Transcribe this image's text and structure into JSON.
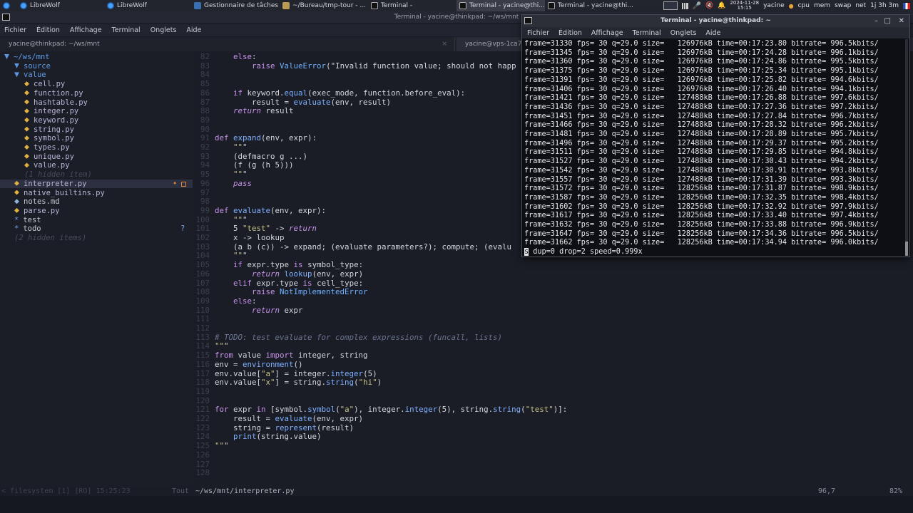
{
  "taskbar": {
    "tasks": [
      {
        "label": "LibreWolf",
        "icon": "librewolf-icon"
      },
      {
        "label": "LibreWolf",
        "icon": "librewolf-icon"
      },
      {
        "label": "Gestionnaire de tâches",
        "icon": "task-manager-icon"
      },
      {
        "label": "~/Bureau/tmp-tour - ...",
        "icon": "folder-icon"
      },
      {
        "label": "Terminal -",
        "icon": "terminal-icon"
      },
      {
        "label": "Terminal - yacine@thi...",
        "icon": "terminal-icon"
      },
      {
        "label": "Terminal - yacine@thi...",
        "icon": "terminal-icon"
      }
    ],
    "tray": {
      "date": "2024-11-28",
      "time": "15:15",
      "user": "yacine",
      "cpu": "cpu",
      "mem": "mem",
      "swap": "swap",
      "net": "net",
      "uptime": "1j 3h 3m"
    }
  },
  "editor": {
    "title": "Terminal - yacine@thinkpad: ~/ws/mnt",
    "menu": [
      "Fichier",
      "Édition",
      "Affichage",
      "Terminal",
      "Onglets",
      "Aide"
    ],
    "tabs": [
      "yacine@thinkpad: ~/ws/mnt",
      "yacine@vps-1ca7..."
    ],
    "tree": [
      {
        "label": "~/ws/mnt",
        "kind": "dir"
      },
      {
        "label": "source",
        "kind": "dir"
      },
      {
        "label": "value",
        "kind": "dir"
      },
      {
        "label": "cell.py",
        "kind": "py"
      },
      {
        "label": "function.py",
        "kind": "py"
      },
      {
        "label": "hashtable.py",
        "kind": "py"
      },
      {
        "label": "integer.py",
        "kind": "py"
      },
      {
        "label": "keyword.py",
        "kind": "py"
      },
      {
        "label": "string.py",
        "kind": "py"
      },
      {
        "label": "symbol.py",
        "kind": "py"
      },
      {
        "label": "types.py",
        "kind": "py"
      },
      {
        "label": "unique.py",
        "kind": "py"
      },
      {
        "label": "value.py",
        "kind": "py"
      },
      {
        "label": "(1 hidden item)",
        "kind": "hidden"
      },
      {
        "label": "interpreter.py",
        "kind": "py"
      },
      {
        "label": "native_builtins.py",
        "kind": "py"
      },
      {
        "label": "notes.md",
        "kind": "md"
      },
      {
        "label": "parse.py",
        "kind": "py"
      },
      {
        "label": "test",
        "kind": "star"
      },
      {
        "label": "todo",
        "kind": "star"
      },
      {
        "label": "(2 hidden items)",
        "kind": "hidden"
      }
    ],
    "tree_marks": {
      "modified": "•",
      "question": "?"
    },
    "code": [
      {
        "n": "82",
        "t": "    else:"
      },
      {
        "n": "83",
        "t": "        raise ValueError(\"Invalid function value; should not happ"
      },
      {
        "n": "84",
        "t": ""
      },
      {
        "n": "85",
        "t": ""
      },
      {
        "n": "86",
        "t": "    if keyword.equal(exec_mode, function.before_eval):"
      },
      {
        "n": "87",
        "t": "        result = evaluate(env, result)"
      },
      {
        "n": "88",
        "t": "    return result"
      },
      {
        "n": "89",
        "t": ""
      },
      {
        "n": "90",
        "t": ""
      },
      {
        "n": "91",
        "t": "def expand(env, expr):"
      },
      {
        "n": "92",
        "t": "    \"\"\""
      },
      {
        "n": "93",
        "t": "    (defmacro g ...)"
      },
      {
        "n": "94",
        "t": "    (f (g (h 5)))"
      },
      {
        "n": "95",
        "t": "    \"\"\""
      },
      {
        "n": "96",
        "t": "    pass"
      },
      {
        "n": "97",
        "t": ""
      },
      {
        "n": "98",
        "t": ""
      },
      {
        "n": "99",
        "t": "def evaluate(env, expr):"
      },
      {
        "n": "100",
        "t": "    \"\"\""
      },
      {
        "n": "101",
        "t": "    5 \"test\" -> return"
      },
      {
        "n": "102",
        "t": "    x -> lookup"
      },
      {
        "n": "103",
        "t": "    (a b (c)) -> expand; (evaluate parameters?); compute; (evalu"
      },
      {
        "n": "104",
        "t": "    \"\"\""
      },
      {
        "n": "105",
        "t": "    if expr.type is symbol_type:"
      },
      {
        "n": "106",
        "t": "        return lookup(env, expr)"
      },
      {
        "n": "107",
        "t": "    elif expr.type is cell_type:"
      },
      {
        "n": "108",
        "t": "        raise NotImplementedError"
      },
      {
        "n": "109",
        "t": "    else:"
      },
      {
        "n": "110",
        "t": "        return expr"
      },
      {
        "n": "111",
        "t": ""
      },
      {
        "n": "112",
        "t": ""
      },
      {
        "n": "113",
        "t": "# TODO: test evaluate for complex expressions (funcall, lists)"
      },
      {
        "n": "114",
        "t": "\"\"\""
      },
      {
        "n": "115",
        "t": "from value import integer, string"
      },
      {
        "n": "116",
        "t": "env = environment()"
      },
      {
        "n": "117",
        "t": "env.value[\"a\"] = integer.integer(5)"
      },
      {
        "n": "118",
        "t": "env.value[\"x\"] = string.string(\"hi\")"
      },
      {
        "n": "119",
        "t": ""
      },
      {
        "n": "120",
        "t": ""
      },
      {
        "n": "121",
        "t": "for expr in [symbol.symbol(\"a\"), integer.integer(5), string.string(\"test\")]:"
      },
      {
        "n": "122",
        "t": "    result = evaluate(env, expr)"
      },
      {
        "n": "123",
        "t": "    string = represent(result)"
      },
      {
        "n": "124",
        "t": "    print(string.value)"
      },
      {
        "n": "125",
        "t": "\"\"\""
      },
      {
        "n": "126",
        "t": ""
      },
      {
        "n": "127",
        "t": ""
      },
      {
        "n": "128",
        "t": ""
      }
    ],
    "status": {
      "left": "< filesystem [1] [RO] 15:25:23",
      "tout": "Tout",
      "path": "~/ws/mnt/interpreter.py",
      "position": "96,7",
      "percent": "82%"
    }
  },
  "terminal": {
    "title": "Terminal - yacine@thinkpad: ~",
    "menu": [
      "Fichier",
      "Édition",
      "Affichage",
      "Terminal",
      "Onglets",
      "Aide"
    ],
    "lines": [
      "frame=31330 fps= 30 q=29.0 size=   126976kB time=00:17:23.80 bitrate= 996.5kbits/",
      "frame=31345 fps= 30 q=29.0 size=   126976kB time=00:17:24.28 bitrate= 996.1kbits/",
      "frame=31360 fps= 30 q=29.0 size=   126976kB time=00:17:24.86 bitrate= 995.5kbits/",
      "frame=31375 fps= 30 q=29.0 size=   126976kB time=00:17:25.34 bitrate= 995.1kbits/",
      "frame=31391 fps= 30 q=29.0 size=   126976kB time=00:17:25.82 bitrate= 994.6kbits/",
      "frame=31406 fps= 30 q=29.0 size=   126976kB time=00:17:26.40 bitrate= 994.1kbits/",
      "frame=31421 fps= 30 q=29.0 size=   127488kB time=00:17:26.88 bitrate= 997.6kbits/",
      "frame=31436 fps= 30 q=29.0 size=   127488kB time=00:17:27.36 bitrate= 997.2kbits/",
      "frame=31451 fps= 30 q=29.0 size=   127488kB time=00:17:27.84 bitrate= 996.7kbits/",
      "frame=31466 fps= 30 q=29.0 size=   127488kB time=00:17:28.32 bitrate= 996.2kbits/",
      "frame=31481 fps= 30 q=29.0 size=   127488kB time=00:17:28.89 bitrate= 995.7kbits/",
      "frame=31496 fps= 30 q=29.0 size=   127488kB time=00:17:29.37 bitrate= 995.2kbits/",
      "frame=31511 fps= 30 q=29.0 size=   127488kB time=00:17:29.85 bitrate= 994.8kbits/",
      "frame=31527 fps= 30 q=29.0 size=   127488kB time=00:17:30.43 bitrate= 994.2kbits/",
      "frame=31542 fps= 30 q=29.0 size=   127488kB time=00:17:30.91 bitrate= 993.8kbits/",
      "frame=31557 fps= 30 q=29.0 size=   127488kB time=00:17:31.39 bitrate= 993.3kbits/",
      "frame=31572 fps= 30 q=29.0 size=   128256kB time=00:17:31.87 bitrate= 998.9kbits/",
      "frame=31587 fps= 30 q=29.0 size=   128256kB time=00:17:32.35 bitrate= 998.4kbits/",
      "frame=31602 fps= 30 q=29.0 size=   128256kB time=00:17:32.92 bitrate= 997.9kbits/",
      "frame=31617 fps= 30 q=29.0 size=   128256kB time=00:17:33.40 bitrate= 997.4kbits/",
      "frame=31632 fps= 30 q=29.0 size=   128256kB time=00:17:33.88 bitrate= 996.9kbits/",
      "frame=31647 fps= 30 q=29.0 size=   128256kB time=00:17:34.36 bitrate= 996.5kbits/",
      "frame=31662 fps= 30 q=29.0 size=   128256kB time=00:17:34.94 bitrate= 996.0kbits/"
    ],
    "last_cursor": "s",
    "last_rest": " dup=0 drop=2 speed=0.999x"
  }
}
